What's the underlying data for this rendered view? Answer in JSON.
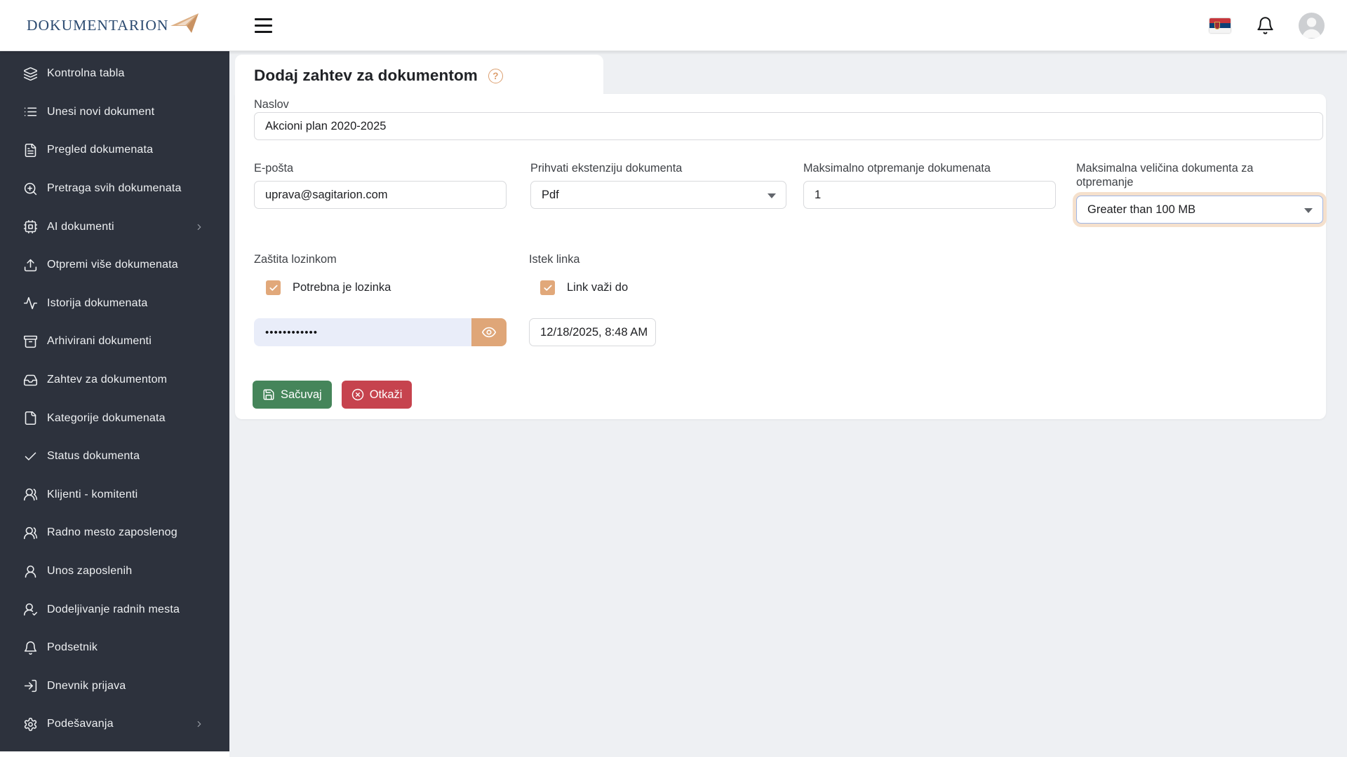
{
  "brand": {
    "name": "DOKUMENTARION"
  },
  "topbar": {
    "icons": [
      "hamburger-icon",
      "serbia-flag-icon",
      "bell-icon",
      "avatar"
    ]
  },
  "sidebar": {
    "items": [
      {
        "label": "Kontrolna tabla",
        "icon": "layers-icon",
        "submenu": false
      },
      {
        "label": "Unesi novi dokument",
        "icon": "list-icon",
        "submenu": false
      },
      {
        "label": "Pregled dokumenata",
        "icon": "file-text-icon",
        "submenu": false
      },
      {
        "label": "Pretraga svih dokumenata",
        "icon": "zoom-in-icon",
        "submenu": false
      },
      {
        "label": "AI dokumenti",
        "icon": "cpu-icon",
        "submenu": true
      },
      {
        "label": "Otpremi više dokumenata",
        "icon": "upload-icon",
        "submenu": false
      },
      {
        "label": "Istorija dokumenata",
        "icon": "activity-icon",
        "submenu": false
      },
      {
        "label": "Arhivirani dokumenti",
        "icon": "archive-icon",
        "submenu": false
      },
      {
        "label": "Zahtev za dokumentom",
        "icon": "inbox-icon",
        "submenu": false
      },
      {
        "label": "Kategorije dokumenata",
        "icon": "file-icon",
        "submenu": false
      },
      {
        "label": "Status dokumenta",
        "icon": "check-icon",
        "submenu": false
      },
      {
        "label": "Klijenti - komitenti",
        "icon": "users-icon",
        "submenu": false
      },
      {
        "label": "Radno mesto zaposlenog",
        "icon": "users-icon",
        "submenu": false
      },
      {
        "label": "Unos zaposlenih",
        "icon": "user-icon",
        "submenu": false
      },
      {
        "label": "Dodeljivanje radnih mesta",
        "icon": "user-check-icon",
        "submenu": false
      },
      {
        "label": "Podsetnik",
        "icon": "bell-icon",
        "submenu": false
      },
      {
        "label": "Dnevnik prijava",
        "icon": "login-icon",
        "submenu": false
      },
      {
        "label": "Podešavanja",
        "icon": "gear-icon",
        "submenu": true
      }
    ]
  },
  "form": {
    "title": "Dodaj zahtev za dokumentom",
    "naslov": {
      "label": "Naslov",
      "value": "Akcioni plan 2020-2025"
    },
    "email": {
      "label": "E-pošta",
      "value": "uprava@sagitarion.com"
    },
    "extension": {
      "label": "Prihvati ekstenziju dokumenta",
      "value": "Pdf"
    },
    "max_docs": {
      "label": "Maksimalno otpremanje dokumenata",
      "value": "1"
    },
    "max_size": {
      "label": "Maksimalna veličina dokumenta za otpremanje",
      "value": "Greater than 100 MB"
    },
    "password": {
      "section_label": "Zaštita lozinkom",
      "checkbox_label": "Potrebna je lozinka",
      "checked": true,
      "masked_value": "••••••••••••"
    },
    "expiry": {
      "section_label": "Istek linka",
      "checkbox_label": "Link važi do",
      "checked": true,
      "value": "12/18/2025, 8:48 AM"
    },
    "help_icon": "?",
    "save_label": "Sačuvaj",
    "cancel_label": "Otkaži"
  },
  "colors": {
    "accent_tan": "#e1a87a",
    "highlight_border": "#9eb5e6",
    "highlight_glow": "#f5e0cc",
    "save_green": "#45855a",
    "cancel_red": "#c6434e",
    "sidebar_bg": "#2d323d",
    "page_bg": "#eef0f3",
    "password_bg": "#e9edf9",
    "logo_navy": "#2b4a70"
  }
}
